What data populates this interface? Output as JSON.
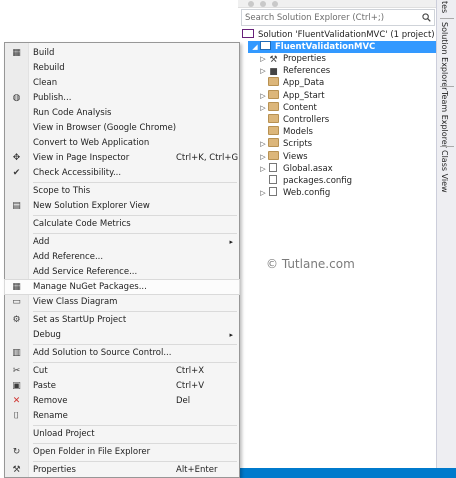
{
  "explorer": {
    "search_placeholder": "Search Solution Explorer (Ctrl+;)",
    "solution_label": "Solution 'FluentValidationMVC' (1 project)",
    "project_label": "FluentValidationMVC",
    "items": [
      {
        "label": "Properties",
        "icon": "wrench-icon",
        "arrow": "▷"
      },
      {
        "label": "References",
        "icon": "references-icon",
        "arrow": "▷"
      },
      {
        "label": "App_Data",
        "icon": "folder-icon",
        "arrow": ""
      },
      {
        "label": "App_Start",
        "icon": "folder-icon",
        "arrow": "▷"
      },
      {
        "label": "Content",
        "icon": "folder-icon",
        "arrow": "▷"
      },
      {
        "label": "Controllers",
        "icon": "folder-icon",
        "arrow": ""
      },
      {
        "label": "Models",
        "icon": "folder-icon",
        "arrow": ""
      },
      {
        "label": "Scripts",
        "icon": "folder-icon",
        "arrow": "▷"
      },
      {
        "label": "Views",
        "icon": "folder-icon",
        "arrow": "▷"
      },
      {
        "label": "Global.asax",
        "icon": "file-icon",
        "arrow": "▷"
      },
      {
        "label": "packages.config",
        "icon": "file-icon",
        "arrow": ""
      },
      {
        "label": "Web.config",
        "icon": "file-icon",
        "arrow": "▷"
      }
    ],
    "selection_color": "#3399ff"
  },
  "side_tabs": {
    "top_cut": "tes",
    "solution_explorer": "Solution Explorer",
    "team_explorer": "Team Explorer",
    "class_view": "Class View"
  },
  "watermark": "© Tutlane.com",
  "menu": {
    "build": "Build",
    "rebuild": "Rebuild",
    "clean": "Clean",
    "publish": "Publish...",
    "run_code_analysis": "Run Code Analysis",
    "view_in_browser": "View in Browser (Google Chrome)",
    "convert": "Convert to Web Application",
    "view_in_page_inspector": "View in Page Inspector",
    "view_in_page_inspector_shortcut": "Ctrl+K, Ctrl+G",
    "check_accessibility": "Check Accessibility...",
    "scope_to_this": "Scope to This",
    "new_solution_explorer_view": "New Solution Explorer View",
    "calculate_code_metrics": "Calculate Code Metrics",
    "add": "Add",
    "add_reference": "Add Reference...",
    "add_service_reference": "Add Service Reference...",
    "manage_nuget": "Manage NuGet Packages...",
    "view_class_diagram": "View Class Diagram",
    "set_as_startup": "Set as StartUp Project",
    "debug": "Debug",
    "add_to_source_control": "Add Solution to Source Control...",
    "cut": "Cut",
    "cut_shortcut": "Ctrl+X",
    "paste": "Paste",
    "paste_shortcut": "Ctrl+V",
    "remove": "Remove",
    "remove_shortcut": "Del",
    "rename": "Rename",
    "unload_project": "Unload Project",
    "open_folder": "Open Folder in File Explorer",
    "properties": "Properties",
    "properties_shortcut": "Alt+Enter",
    "submenu_arrow": "▸"
  }
}
